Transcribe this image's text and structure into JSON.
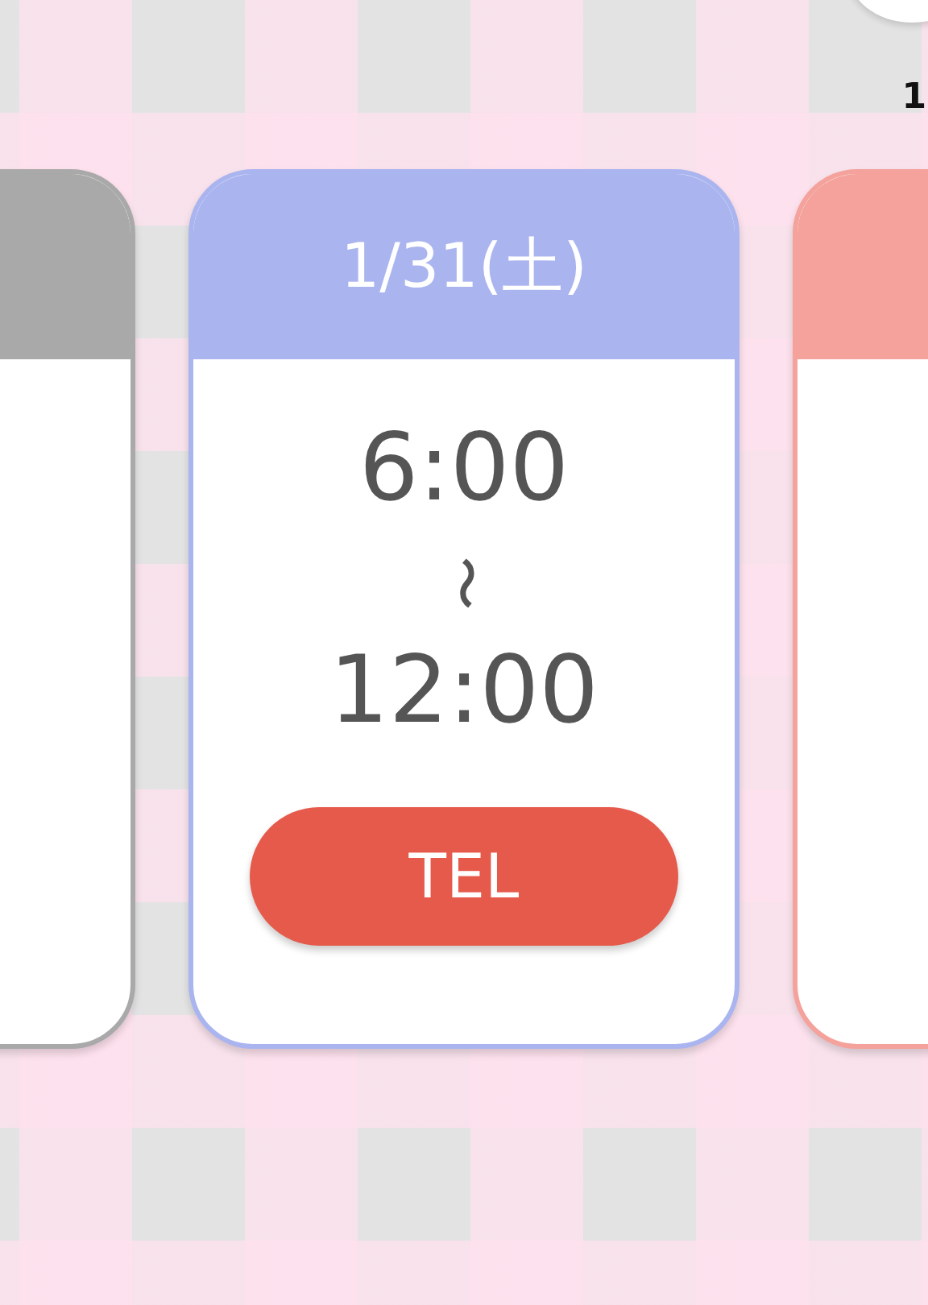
{
  "corner_label": "1",
  "cards": [
    {
      "color": "#a9a9a9"
    },
    {
      "color": "#aab5ef",
      "date": "1/31(土)",
      "start": "6:00",
      "separator": "〜",
      "end": "12:00",
      "button": "TEL"
    },
    {
      "color": "#f4a29b"
    }
  ]
}
